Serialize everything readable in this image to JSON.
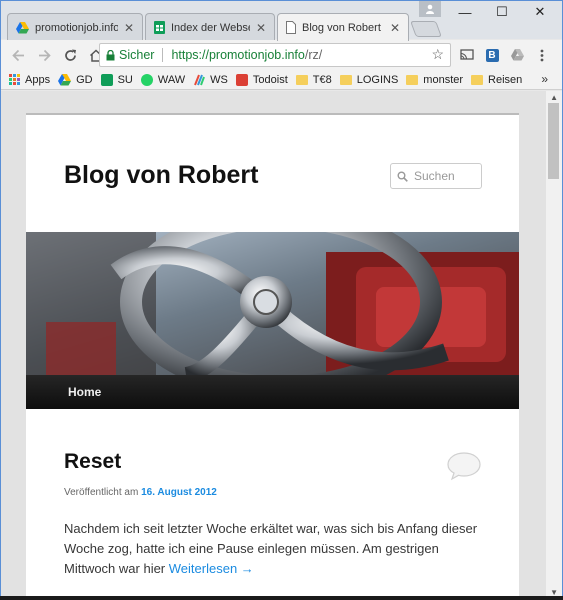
{
  "browser": {
    "tabs": [
      {
        "title": "promotionjob.info",
        "active": false
      },
      {
        "title": "Index der Webseite",
        "active": false
      },
      {
        "title": "Blog von Robert",
        "active": true
      }
    ],
    "tab_close_glyph": "✕",
    "window_controls": {
      "minimize": "—",
      "maximize": "☐",
      "close": "✕"
    },
    "omnibox": {
      "security_label": "Sicher",
      "url_main": "https://promotionjob.info",
      "url_rest": "/rz/"
    },
    "bookmarks": [
      {
        "label": "Apps",
        "icon": "apps-grid-icon",
        "color": "#e74c3c"
      },
      {
        "label": "GD",
        "icon": "google-drive-icon",
        "color": "#34a853"
      },
      {
        "label": "SU",
        "icon": "sheets-icon",
        "color": "#0f9d58"
      },
      {
        "label": "WAW",
        "icon": "whatsapp-icon",
        "color": "#25d366"
      },
      {
        "label": "WS",
        "icon": "ws-icon",
        "color": "#7b3fa0"
      },
      {
        "label": "Todoist",
        "icon": "todoist-icon",
        "color": "#db4035"
      },
      {
        "label": "T€8",
        "icon": "folder-icon",
        "color": "#f5cf5c"
      },
      {
        "label": "LOGINS",
        "icon": "folder-icon",
        "color": "#f5cf5c"
      },
      {
        "label": "monster",
        "icon": "folder-icon",
        "color": "#f5cf5c"
      },
      {
        "label": "Reisen",
        "icon": "folder-icon",
        "color": "#f5cf5c"
      }
    ],
    "bookmarks_more": "»",
    "extension_badge": "B"
  },
  "site": {
    "title": "Blog von Robert",
    "search_placeholder": "Suchen",
    "nav": {
      "home": "Home"
    }
  },
  "post": {
    "title": "Reset",
    "meta_prefix": "Veröffentlicht am",
    "date": "16. August 2012",
    "body": "Nachdem ich seit letzter Woche erkältet war, was sich bis Anfang dieser Woche zog, hatte ich eine Pause einlegen müssen. Am gestrigen Mittwoch war hier",
    "read_more": "Weiterlesen →"
  },
  "colors": {
    "link": "#1b8be0",
    "secure": "#188038",
    "nav_bg": "#111111"
  }
}
